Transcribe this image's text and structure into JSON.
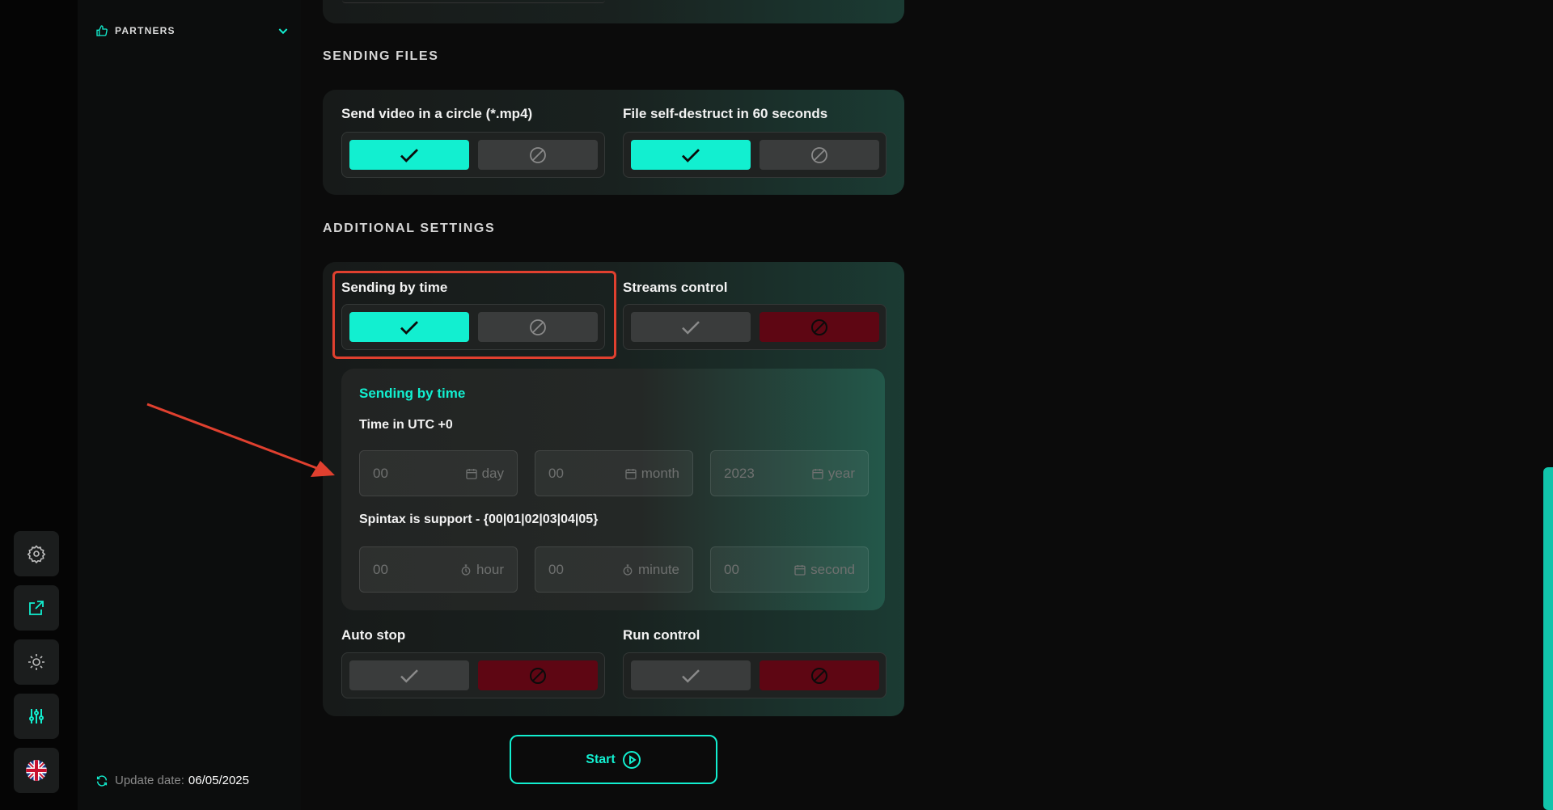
{
  "sidebar": {
    "partners_label": "PARTNERS",
    "update_label": "Update date:",
    "update_value": "06/05/2025"
  },
  "rail": {
    "icons": [
      "gear-icon",
      "external-link-icon",
      "sun-icon",
      "sliders-icon",
      "uk-flag-icon"
    ]
  },
  "sections": {
    "sending_files": "SENDING FILES",
    "additional_settings": "ADDITIONAL SETTINGS"
  },
  "files": {
    "video_circle_label": "Send video in a circle (*.mp4)",
    "self_destruct_label": "File self-destruct in 60 seconds"
  },
  "additional": {
    "sending_by_time_label": "Sending by time",
    "streams_control_label": "Streams control",
    "auto_stop_label": "Auto stop",
    "run_control_label": "Run control"
  },
  "schedule": {
    "title": "Sending by time",
    "time_label": "Time in UTC +0",
    "spintax_label": "Spintax is support - {00|01|02|03|04|05}",
    "day": {
      "value": "00",
      "unit": "day"
    },
    "month": {
      "value": "00",
      "unit": "month"
    },
    "year": {
      "value": "2023",
      "unit": "year"
    },
    "hour": {
      "value": "00",
      "unit": "hour"
    },
    "minute": {
      "value": "00",
      "unit": "minute"
    },
    "second": {
      "value": "00",
      "unit": "second"
    }
  },
  "actions": {
    "start_label": "Start"
  },
  "colors": {
    "accent": "#12efd0",
    "danger": "#5e0613",
    "highlight": "#e0402f"
  }
}
